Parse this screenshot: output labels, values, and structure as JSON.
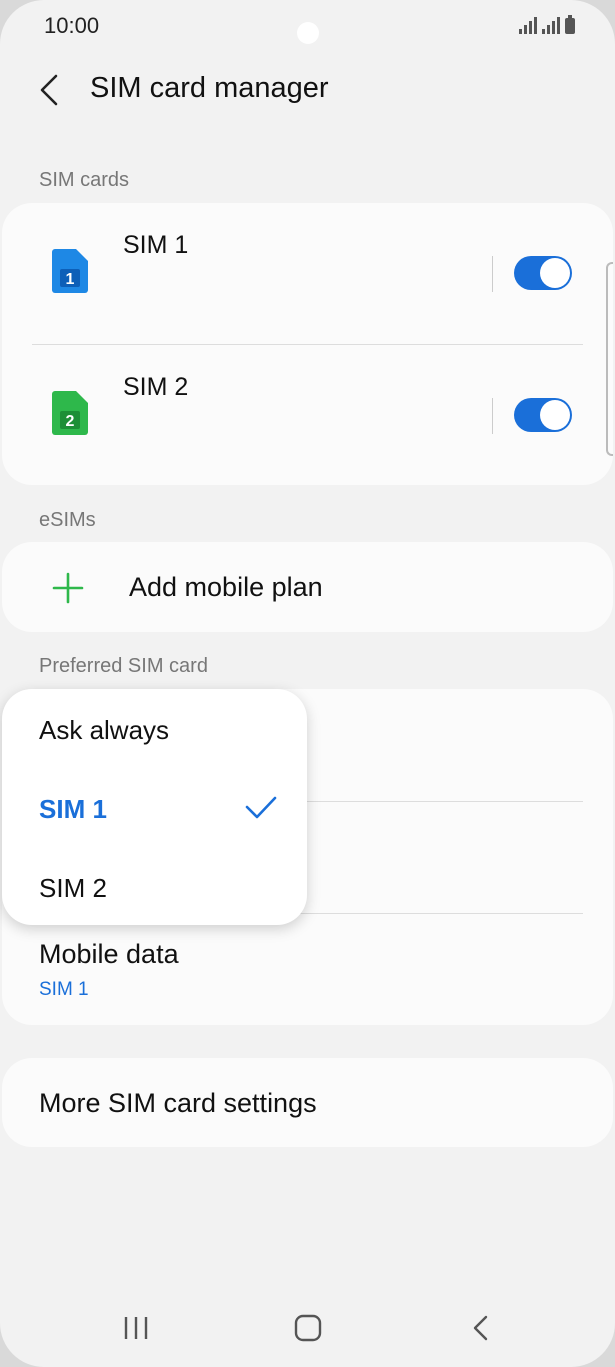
{
  "status_bar": {
    "time": "10:00"
  },
  "header": {
    "title": "SIM card manager"
  },
  "sections": {
    "sim_cards_label": "SIM cards",
    "esims_label": "eSIMs",
    "preferred_label": "Preferred SIM card"
  },
  "sim_cards": [
    {
      "name": "SIM 1",
      "badge": "1",
      "color": "#1e88e5",
      "enabled": true
    },
    {
      "name": "SIM 2",
      "badge": "2",
      "color": "#2eb84b",
      "enabled": true
    }
  ],
  "esims": {
    "add_label": "Add mobile plan"
  },
  "preferred": {
    "mobile_data_label": "Mobile data",
    "mobile_data_value": "SIM 1"
  },
  "popup": {
    "options": [
      "Ask always",
      "SIM 1",
      "SIM 2"
    ],
    "selected": "SIM 1"
  },
  "more": {
    "label": "More SIM card settings"
  },
  "colors": {
    "accent": "#1a6fd9",
    "plus": "#2eb84b",
    "background": "#f2f2f2"
  },
  "icons": {
    "back": "chevron-left-icon",
    "plus": "plus-icon",
    "check": "check-icon",
    "nav": [
      "recent-apps-icon",
      "home-icon",
      "back-icon"
    ]
  }
}
